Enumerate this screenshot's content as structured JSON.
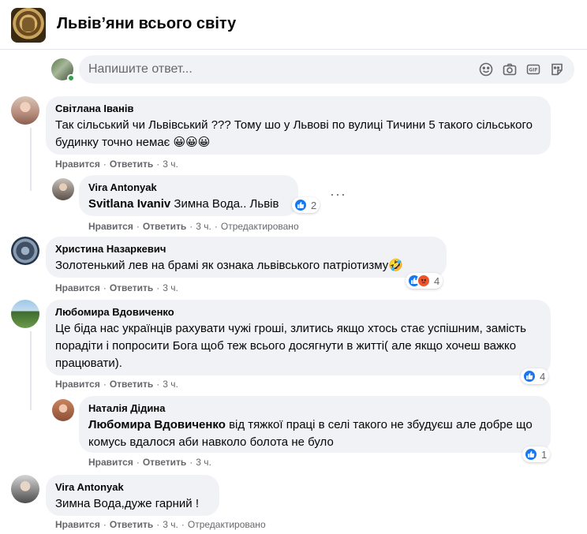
{
  "group": {
    "title": "Львів’яни всього світу"
  },
  "reply": {
    "placeholder": "Напишите ответ..."
  },
  "tools": [
    "emoji-icon",
    "camera-icon",
    "gif-icon",
    "sticker-icon"
  ],
  "actions": {
    "like": "Нравится",
    "reply": "Ответить",
    "edited": "Отредактировано"
  },
  "comments": [
    {
      "author": "Світлана Іванів",
      "text": "Так сільський чи Львівський ??? Тому шо у Львові по вулиці Тичини 5 такого сільського будинку точно немає 😀😀😀",
      "time": "3 ч."
    },
    {
      "author": "Vira Antonyak",
      "mention": "Svitlana Ivaniv",
      "text": "Зимна Вода.. Львів",
      "time": "3 ч.",
      "edited": true,
      "reactions": {
        "types": [
          "like"
        ],
        "count": "2"
      }
    },
    {
      "author": "Христина Назаркевич",
      "text": "Золотенький лев на брамі як ознака львівського патріотизму🤣",
      "time": "3 ч.",
      "reactions": {
        "types": [
          "like",
          "angry"
        ],
        "count": "4"
      }
    },
    {
      "author": "Любомира Вдовиченко",
      "text": "Це біда нас українців рахувати чужі гроші, злитись якщо хтось стає успішним, замість порадіти і попросити Бога щоб теж всього досягнути в житті( але якщо хочеш важко працювати).",
      "time": "3 ч.",
      "reactions": {
        "types": [
          "like"
        ],
        "count": "4"
      }
    },
    {
      "author": "Наталія Дідина",
      "mention": "Любомира Вдовиченко",
      "text": "від тяжкої праці в селі такого не збудуєш але добре що комусь вдалося аби навколо болота не було",
      "time": "3 ч.",
      "reactions": {
        "types": [
          "like"
        ],
        "count": "1"
      }
    },
    {
      "author": "Vira Antonyak",
      "text": "Зимна Вода,дуже гарний !",
      "time": "3 ч.",
      "edited": true
    }
  ],
  "colors": {
    "like": "#1877f2",
    "angry": "#f0542c",
    "bubble": "#f0f2f5",
    "meta": "#65676b",
    "online": "#31a24c"
  }
}
